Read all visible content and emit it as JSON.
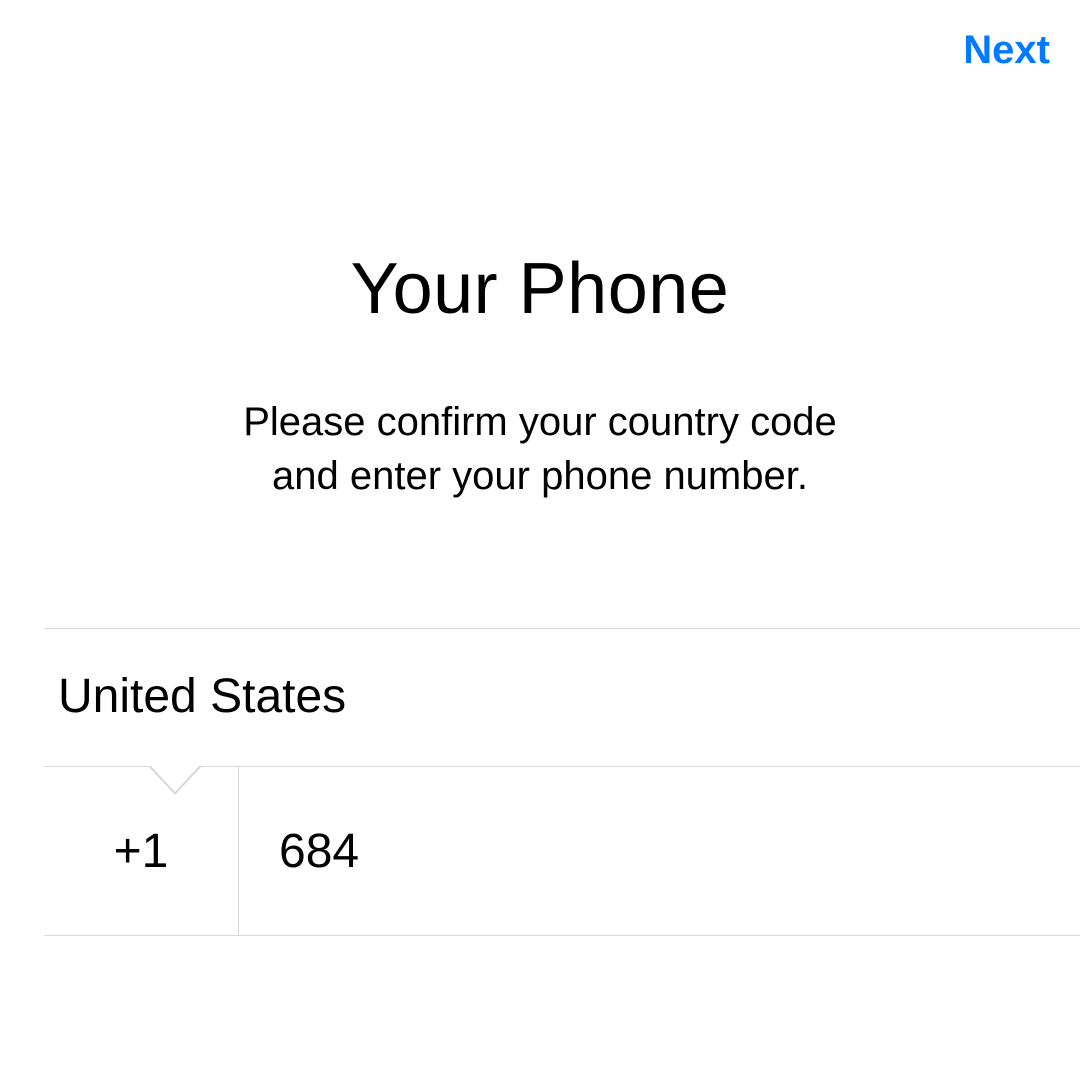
{
  "colors": {
    "accent": "#007aff",
    "border": "#d9d9d9",
    "caret": "#9bbfe0",
    "text": "#000000",
    "bg": "#ffffff"
  },
  "nav": {
    "next": "Next"
  },
  "page": {
    "title": "Your Phone",
    "subtitle_line1": "Please confirm your country code",
    "subtitle_line2": "and enter your phone number."
  },
  "form": {
    "country": "United States",
    "dial_code": "+1",
    "phone_value": "684",
    "phone_placeholder": ""
  }
}
